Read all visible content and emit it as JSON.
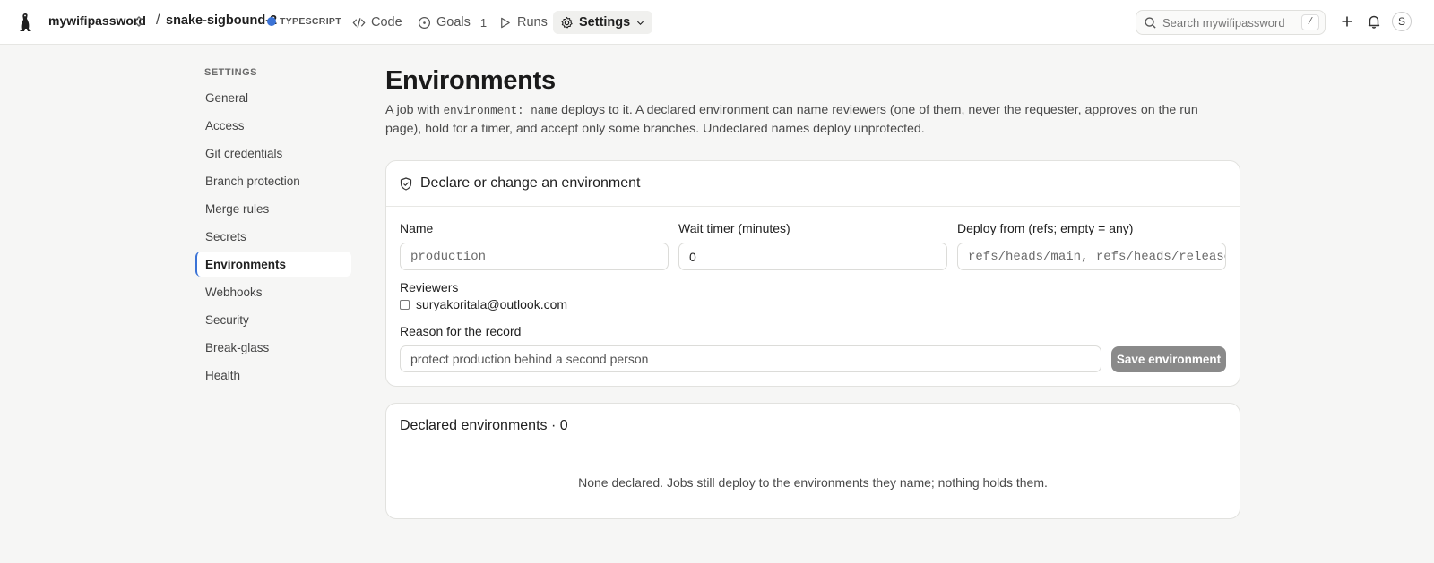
{
  "header": {
    "org": "mywifipassword",
    "separator": "/",
    "repo": "snake-sigbound-2",
    "language": "TYPESCRIPT",
    "nav": [
      {
        "label": "Code",
        "icon": "code-icon"
      },
      {
        "label": "Goals",
        "icon": "goal-circle-icon",
        "count": "1"
      },
      {
        "label": "Runs",
        "icon": "play-icon"
      },
      {
        "label": "Settings",
        "icon": "gear-icon",
        "active": true
      }
    ],
    "search_placeholder": "Search mywifipassword",
    "search_shortcut": "/",
    "avatar_initial": "S"
  },
  "sidebar": {
    "title": "SETTINGS",
    "items": [
      "General",
      "Access",
      "Git credentials",
      "Branch protection",
      "Merge rules",
      "Secrets",
      "Environments",
      "Webhooks",
      "Security",
      "Break-glass",
      "Health"
    ],
    "active": "Environments"
  },
  "page": {
    "title": "Environments",
    "desc_before": "A job with ",
    "desc_code": "environment: name",
    "desc_after": " deploys to it. A declared environment can name reviewers (one of them, never the requester, approves on the run page), hold for a timer, and accept only some branches. Undeclared names deploy unprotected."
  },
  "form": {
    "heading": "Declare or change an environment",
    "name_label": "Name",
    "name_placeholder": "production",
    "wait_label": "Wait timer (minutes)",
    "wait_value": "0",
    "deploy_label": "Deploy from (refs; empty = any)",
    "deploy_placeholder": "refs/heads/main, refs/heads/release/*",
    "reviewers_label": "Reviewers",
    "reviewer_email": "suryakoritala@outlook.com",
    "reviewer_checked": false,
    "reason_label": "Reason for the record",
    "reason_placeholder": "protect production behind a second person",
    "save_label": "Save environment"
  },
  "declared": {
    "heading": "Declared environments · 0",
    "empty_text": "None declared. Jobs still deploy to the environments they name; nothing holds them."
  }
}
